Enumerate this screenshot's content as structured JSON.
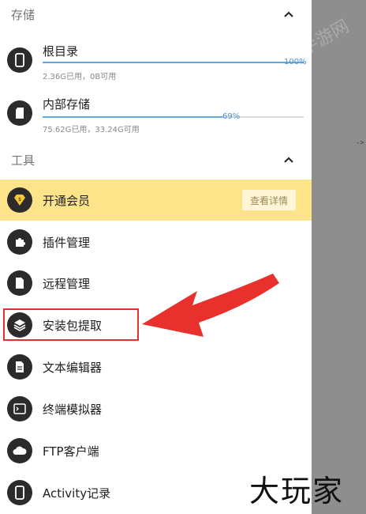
{
  "sections": {
    "storage": {
      "title": "存储"
    },
    "tools": {
      "title": "工具"
    }
  },
  "storage_items": [
    {
      "name": "根目录",
      "usage": "2.36G已用，0B可用",
      "percent_label": "100%",
      "percent": 100,
      "icon": "phone-icon"
    },
    {
      "name": "内部存储",
      "usage": "75.62G已用，33.24G可用",
      "percent_label": "69%",
      "percent": 69,
      "icon": "sd-card-icon"
    }
  ],
  "vip": {
    "label": "开通会员",
    "button": "查看详情",
    "icon": "vip-diamond-icon"
  },
  "tools": [
    {
      "label": "插件管理",
      "icon": "puzzle-icon"
    },
    {
      "label": "远程管理",
      "icon": "file-icon"
    },
    {
      "label": "安装包提取",
      "icon": "layers-icon"
    },
    {
      "label": "文本编辑器",
      "icon": "document-icon"
    },
    {
      "label": "终端模拟器",
      "icon": "terminal-icon"
    },
    {
      "label": "FTP客户端",
      "icon": "cloud-icon"
    },
    {
      "label": "Activity记录",
      "icon": "phone-icon"
    }
  ],
  "overlay": {
    "arrow_text": "->",
    "watermark": "大玩家",
    "faint_watermark": "手游网"
  },
  "colors": {
    "accent_blue": "#4a90d9",
    "vip_yellow": "#fde48a",
    "highlight_red": "#e3312d",
    "icon_dark": "#2b2b2b"
  }
}
